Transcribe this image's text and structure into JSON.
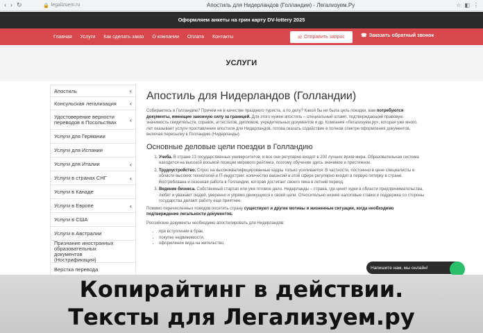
{
  "browser": {
    "url": "legalizuem.ru",
    "tab_title": "Апостиль для Нидерландов (Голландии) - Легализуем.Ру"
  },
  "promo": {
    "text": "Оформляем анкеты на грин карту DV-lottery 2025"
  },
  "nav": {
    "items": [
      "Главная",
      "Услуги",
      "Как сделать заказ",
      "О компании",
      "Оплата",
      "Контакты"
    ],
    "send_request": "Отправить запрос",
    "callback": "Заказать обратный звонок"
  },
  "page_header": {
    "title": "УСЛУГИ"
  },
  "sidebar": {
    "items": [
      {
        "label": "Апостиль",
        "chevron": true
      },
      {
        "label": "Консульская легализация",
        "chevron": true
      },
      {
        "label": "Удостоверение верности переводов в Посольствах",
        "chevron": true
      },
      {
        "label": "Услуги для Германии",
        "chevron": false
      },
      {
        "label": "Услуги для Испании",
        "chevron": false
      },
      {
        "label": "Услуги для Италии",
        "chevron": true
      },
      {
        "label": "Услуги в странах СНГ",
        "chevron": true
      },
      {
        "label": "Услуги в Канаде",
        "chevron": false
      },
      {
        "label": "Услуги в Европе",
        "chevron": true
      },
      {
        "label": "Услуги в США",
        "chevron": false
      },
      {
        "label": "Услуги в Австралии",
        "chevron": false
      },
      {
        "label": "Признание иностранных образовательных документов (Нострификация)",
        "chevron": false
      },
      {
        "label": "Верстка перевода",
        "chevron": false
      }
    ]
  },
  "main": {
    "title": "Апостиль для Нидерландов (Голландии)",
    "intro_1": "Собираетесь в Голландию? Причем не в качестве праздного туриста, а по делу? Какой бы ни была цель поездки, вам ",
    "intro_bold": "потребуются документы, имеющие законную силу за границей.",
    "intro_2": " Для этого нужен апостиль – специальный штамп, подтверждающий правовую значимость свидетельств, справок, аттестатов, дипломов, учредительных документов и др. Компания «Легализуем.ру», которая уже много лет оказывает услуги проставления апостиля для Нидерландов, готова оказать содействие в полном спектре оформления документов, включая пересылку в Голландию (Нидерланды).",
    "subtitle": "Основные деловые цели поездки в Голландию",
    "goals": [
      {
        "bold": "Учеба.",
        "text": " В стране 13 государственных университетов, и все они регулярно входят в 200 лучших вузов мира. Образовательная система находится на высокой восьмой позиции мирового рейтинга, поэтому обучение здесь значимое и престижное."
      },
      {
        "bold": "Трудоустройство.",
        "text": " Спрос на высококвалифицированные кадры только усиливается. В частности, постоянно в цене специалисты в области высоких технологий и IT-индустрии: количество вакансий в этой сфере регулярно входит в первую пятерку в стране. Востребована и сезонная работа в Голландии, которая достигает своего пика в летний период."
      },
      {
        "bold": "Ведение бизнеса.",
        "text": " Собственный стартап или уже готовое дело. Нидерланды – страна, где ценят идеи в области предпринимательства, любят и уважают людей, уверенно и упрямо движущихся к своей цели. Относительно низкие налоговые ставки и поддержка со стороны государства делают работу еще приятнее."
      }
    ],
    "para2_1": "Помимо перечисленных поводов посетить страну ",
    "para2_bold": "существуют и другие мотивы и жизненные ситуации, когда необходимо подтверждение легальности документов.",
    "para3": "Российские документы необходимо апостилировать для Нидерландов:",
    "bullets": [
      "при вступлении в брак,",
      "покупке недвижимости,",
      "оформлении вида на жительство,"
    ]
  },
  "chat": {
    "text": "Напишите нам, мы онлайн!"
  },
  "caption": {
    "line1": "Копирайтинг в действии.",
    "line2": "Тексты для Легализуем.ру"
  },
  "colors": {
    "accent": "#d8474b",
    "dark": "#2b2b2b",
    "chat": "#2bbf6b"
  }
}
